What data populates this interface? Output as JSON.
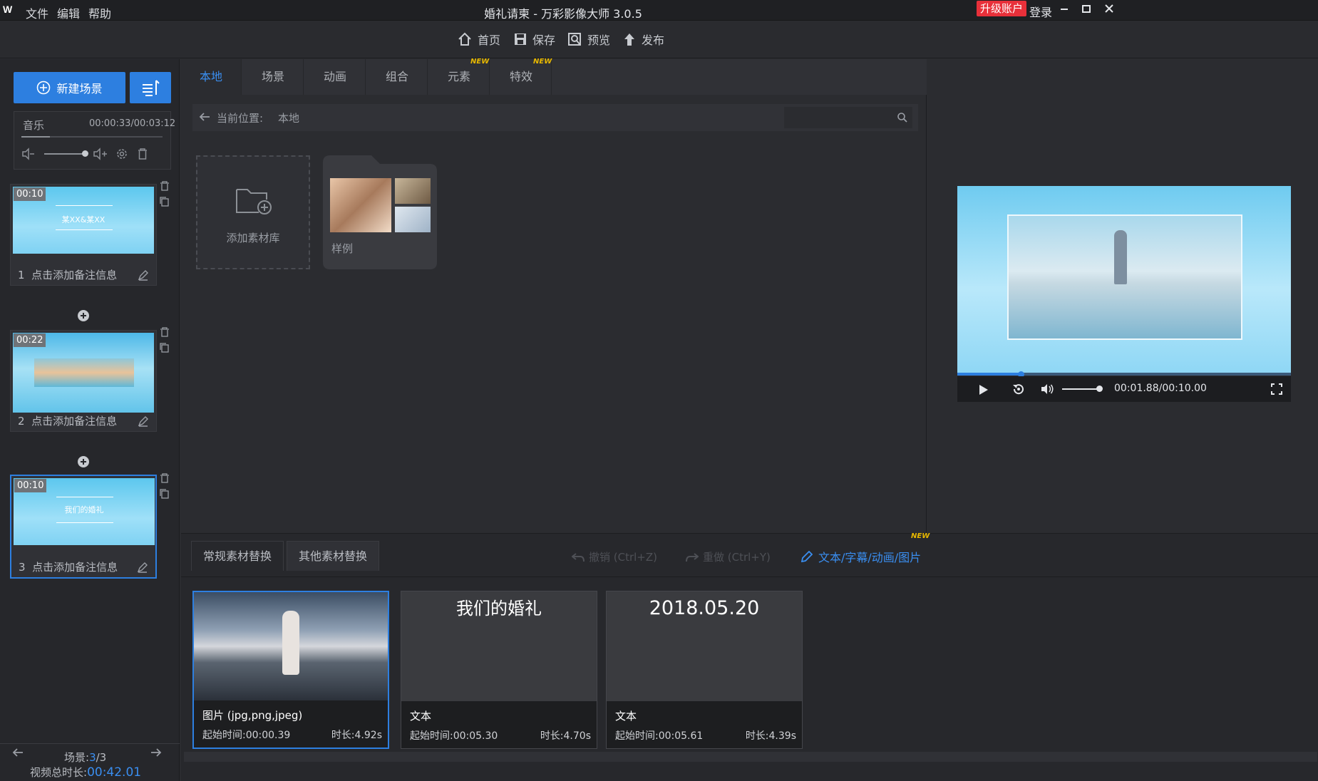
{
  "window": {
    "title": "婚礼请柬 - 万彩影像大师 3.0.5",
    "menu": [
      "文件",
      "编辑",
      "帮助"
    ],
    "upgrade": "升级账户",
    "login": "登录"
  },
  "toolbar": {
    "home": "首页",
    "save": "保存",
    "preview": "预览",
    "publish": "发布"
  },
  "left": {
    "new_scene": "新建场景",
    "music_label": "音乐",
    "music_time": "00:00:33/00:03:12",
    "scenes": [
      {
        "duration": "00:10",
        "index": "1",
        "note": "点击添加备注信息",
        "thumb_text": "某XX&某XX"
      },
      {
        "duration": "00:22",
        "index": "2",
        "note": "点击添加备注信息",
        "thumb_text": ""
      },
      {
        "duration": "00:10",
        "index": "3",
        "note": "点击添加备注信息",
        "thumb_text": "我们的婚礼"
      }
    ],
    "scene_label": "场景:",
    "scene_current": "3",
    "scene_total": "/3",
    "total_label": "视频总时长:",
    "total_value": "00:42.01"
  },
  "center": {
    "tabs": [
      "本地",
      "场景",
      "动画",
      "组合",
      "元素",
      "特效"
    ],
    "new_badge": "NEW",
    "location_label": "当前位置:",
    "location_value": "本地",
    "add_library": "添加素材库",
    "sample": "样例"
  },
  "preview": {
    "time": "00:01.88/00:10.00",
    "progress": 0.19,
    "volume": 1.0
  },
  "bottom": {
    "tabs": [
      "常规素材替换",
      "其他素材替换"
    ],
    "undo": "撤销 (Ctrl+Z)",
    "redo": "重做 (Ctrl+Y)",
    "edit_text": "文本/字幕/动画/图片",
    "new_badge": "NEW",
    "cards": [
      {
        "type": "图片 (jpg,png,jpeg)",
        "start": "起始时间:00:00.39",
        "duration": "时长:4.92s",
        "content": ""
      },
      {
        "type": "文本",
        "start": "起始时间:00:05.30",
        "duration": "时长:4.70s",
        "content": "我们的婚礼"
      },
      {
        "type": "文本",
        "start": "起始时间:00:05.61",
        "duration": "时长:4.39s",
        "content": "2018.05.20"
      }
    ]
  },
  "colors": {
    "accent": "#2d7fe0",
    "upgrade": "#e8303a",
    "badge": "#e8b800"
  }
}
